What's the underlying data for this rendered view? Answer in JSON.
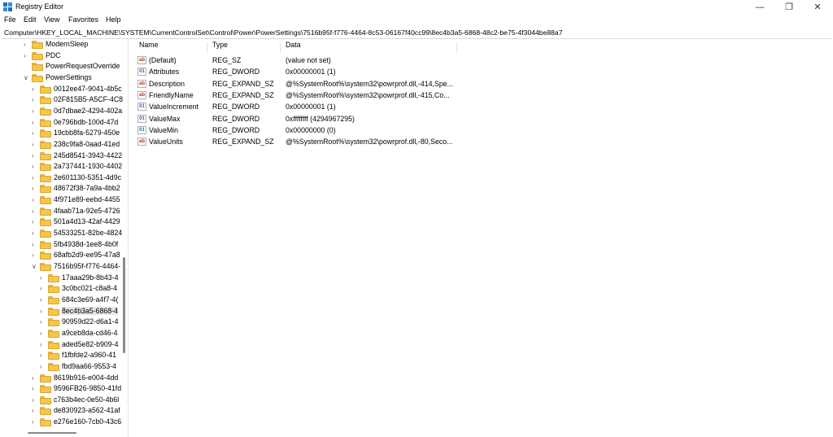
{
  "window": {
    "title": "Registry Editor"
  },
  "menu": [
    "File",
    "Edit",
    "View",
    "Favorites",
    "Help"
  ],
  "address": "Computer\\HKEY_LOCAL_MACHINE\\SYSTEM\\CurrentControlSet\\Control\\Power\\PowerSettings\\7516b95f-f776-4464-8c53-06167f40cc99\\8ec4b3a5-6868-48c2-be75-4f3044be88a7",
  "tree": [
    {
      "label": "ModernSleep",
      "level": 0,
      "chev": "right"
    },
    {
      "label": "PDC",
      "level": 0,
      "chev": "right"
    },
    {
      "label": "PowerRequestOverride",
      "level": 0,
      "chev": "none"
    },
    {
      "label": "PowerSettings",
      "level": 0,
      "chev": "down"
    },
    {
      "label": "0012ee47-9041-4b5c",
      "level": 1,
      "chev": "right"
    },
    {
      "label": "02F815B5-A5CF-4C8",
      "level": 1,
      "chev": "right"
    },
    {
      "label": "0d7dbae2-4294-402a",
      "level": 1,
      "chev": "right"
    },
    {
      "label": "0e796bdb-100d-47d",
      "level": 1,
      "chev": "right"
    },
    {
      "label": "19cbb8fa-5279-450e",
      "level": 1,
      "chev": "right"
    },
    {
      "label": "238c9fa8-0aad-41ed",
      "level": 1,
      "chev": "right"
    },
    {
      "label": "245d8541-3943-4422",
      "level": 1,
      "chev": "right"
    },
    {
      "label": "2a737441-1930-4402",
      "level": 1,
      "chev": "right"
    },
    {
      "label": "2e601130-5351-4d9c",
      "level": 1,
      "chev": "right"
    },
    {
      "label": "48672f38-7a9a-4bb2",
      "level": 1,
      "chev": "right"
    },
    {
      "label": "4f971e89-eebd-4455",
      "level": 1,
      "chev": "right"
    },
    {
      "label": "4faab71a-92e5-4726",
      "level": 1,
      "chev": "right"
    },
    {
      "label": "501a4d13-42af-4429",
      "level": 1,
      "chev": "right"
    },
    {
      "label": "54533251-82be-4824",
      "level": 1,
      "chev": "right"
    },
    {
      "label": "5fb4938d-1ee8-4b0f",
      "level": 1,
      "chev": "right"
    },
    {
      "label": "68afb2d9-ee95-47a8",
      "level": 1,
      "chev": "right"
    },
    {
      "label": "7516b95f-f776-4464-",
      "level": 1,
      "chev": "down"
    },
    {
      "label": "17aaa29b-8b43-4",
      "level": 2,
      "chev": "right"
    },
    {
      "label": "3c0bc021-c8a8-4",
      "level": 2,
      "chev": "right"
    },
    {
      "label": "684c3e69-a4f7-4(",
      "level": 2,
      "chev": "right"
    },
    {
      "label": "8ec4b3a5-6868-4",
      "level": 2,
      "chev": "right",
      "selected": true
    },
    {
      "label": "90959d22-d6a1-4",
      "level": 2,
      "chev": "right"
    },
    {
      "label": "a9ceb8da-cd46-4",
      "level": 2,
      "chev": "right"
    },
    {
      "label": "aded5e82-b909-4",
      "level": 2,
      "chev": "right"
    },
    {
      "label": "f1fbfde2-a960-41",
      "level": 2,
      "chev": "right"
    },
    {
      "label": "fbd9aa66-9553-4",
      "level": 2,
      "chev": "right"
    },
    {
      "label": "8619b916-e004-4dd",
      "level": 1,
      "chev": "right"
    },
    {
      "label": "9596FB26-9850-41fd",
      "level": 1,
      "chev": "right"
    },
    {
      "label": "c763b4ec-0e50-4b6l",
      "level": 1,
      "chev": "right"
    },
    {
      "label": "de830923-a562-41af",
      "level": 1,
      "chev": "right"
    },
    {
      "label": "e276e160-7cb0-43c6",
      "level": 1,
      "chev": "right"
    }
  ],
  "columns": [
    "Name",
    "Type",
    "Data"
  ],
  "values": [
    {
      "name": "(Default)",
      "type": "REG_SZ",
      "data": "(value not set)",
      "icon": "string-value-icon"
    },
    {
      "name": "Attributes",
      "type": "REG_DWORD",
      "data": "0x00000001 (1)",
      "icon": "dword-value-icon"
    },
    {
      "name": "Description",
      "type": "REG_EXPAND_SZ",
      "data": "@%SystemRoot%\\system32\\powrprof.dll,-414,Spe...",
      "icon": "string-value-icon"
    },
    {
      "name": "FriendlyName",
      "type": "REG_EXPAND_SZ",
      "data": "@%SystemRoot%\\system32\\powrprof.dll,-415,Co...",
      "icon": "string-value-icon"
    },
    {
      "name": "ValueIncrement",
      "type": "REG_DWORD",
      "data": "0x00000001 (1)",
      "icon": "dword-value-icon"
    },
    {
      "name": "ValueMax",
      "type": "REG_DWORD",
      "data": "0xffffffff (4294967295)",
      "icon": "dword-value-icon"
    },
    {
      "name": "ValueMin",
      "type": "REG_DWORD",
      "data": "0x00000000 (0)",
      "icon": "dword-value-icon"
    },
    {
      "name": "ValueUnits",
      "type": "REG_EXPAND_SZ",
      "data": "@%SystemRoot%\\system32\\powrprof.dll,-80,Seco...",
      "icon": "string-value-icon"
    }
  ],
  "icons": {
    "app": "registry-editor-icon",
    "minimize": "minimize-icon",
    "maximize": "restore-icon",
    "close": "close-icon"
  },
  "colors": {
    "folder": "#f5c64a",
    "selection": "#e5e5e5",
    "string_icon": "#c42b1c",
    "dword_icon": "#2b5fb3"
  }
}
